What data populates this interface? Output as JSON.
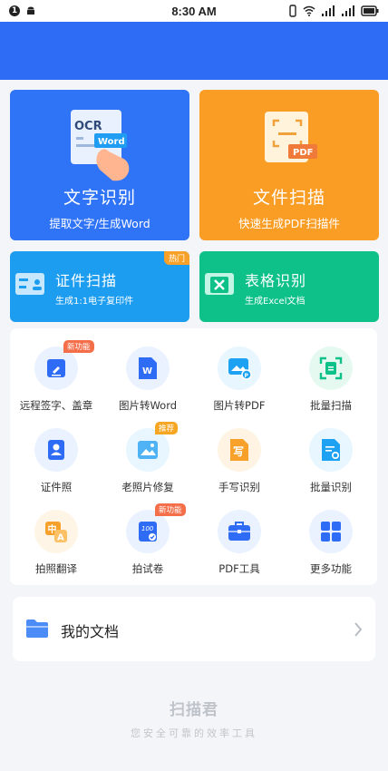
{
  "status_bar": {
    "time": "8:30 AM",
    "notification_count": "1"
  },
  "cards": {
    "ocr": {
      "title": "文字识别",
      "subtitle": "提取文字/生成Word",
      "icon_text_top": "OCR",
      "icon_text_tag": "Word",
      "color": "#2f73f7"
    },
    "doc_scan": {
      "title": "文件扫描",
      "subtitle": "快速生成PDF扫描件",
      "icon_text_tag": "PDF",
      "color": "#fa9d25"
    },
    "id_scan": {
      "title": "证件扫描",
      "subtitle": "生成1:1电子复印件",
      "badge": "热门",
      "color": "#1d9df0"
    },
    "table_ocr": {
      "title": "表格识别",
      "subtitle": "生成Excel文档",
      "color": "#0ec188"
    }
  },
  "tools": [
    {
      "label": "远程签字、盖章",
      "icon": "pen-sign-icon",
      "badge": "新功能"
    },
    {
      "label": "图片转Word",
      "icon": "word-doc-icon"
    },
    {
      "label": "图片转PDF",
      "icon": "image-pdf-icon"
    },
    {
      "label": "批量扫描",
      "icon": "batch-scan-icon"
    },
    {
      "label": "证件照",
      "icon": "id-photo-icon"
    },
    {
      "label": "老照片修复",
      "icon": "photo-repair-icon",
      "badge": "推荐"
    },
    {
      "label": "手写识别",
      "icon": "handwriting-icon",
      "icon_text": "写"
    },
    {
      "label": "批量识别",
      "icon": "batch-recognize-icon"
    },
    {
      "label": "拍照翻译",
      "icon": "translate-icon",
      "icon_text_a": "中",
      "icon_text_b": "A"
    },
    {
      "label": "拍试卷",
      "icon": "exam-paper-icon",
      "badge": "新功能",
      "icon_text": "100"
    },
    {
      "label": "PDF工具",
      "icon": "toolbox-icon"
    },
    {
      "label": "更多功能",
      "icon": "grid-more-icon"
    }
  ],
  "my_docs": {
    "label": "我的文档"
  },
  "footer": {
    "brand": "扫描君",
    "slogan": "您安全可靠的效率工具"
  }
}
